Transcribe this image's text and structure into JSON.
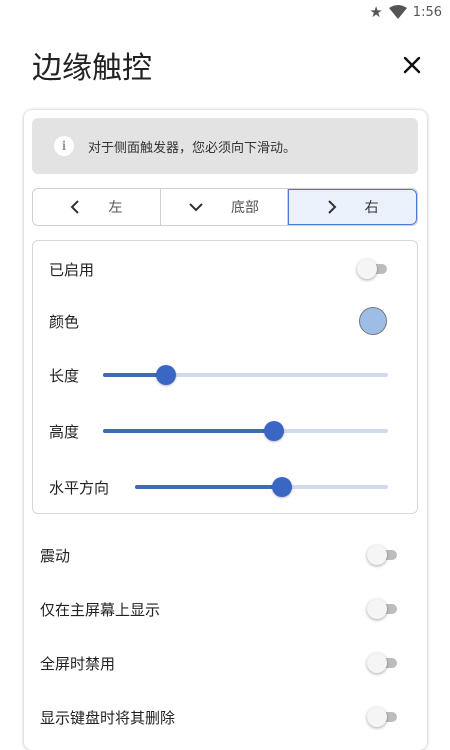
{
  "status_bar": {
    "time": "1:56",
    "icons": [
      "star-icon",
      "wifi-icon",
      "battery-icon"
    ]
  },
  "header": {
    "title": "边缘触控",
    "close_icon": "close-icon"
  },
  "info": {
    "icon": "info-icon",
    "text": "对于侧面触发器，您必须向下滑动。"
  },
  "position_tabs": [
    {
      "label": "左",
      "icon": "chevron-left-icon",
      "selected": false
    },
    {
      "label": "底部",
      "icon": "chevron-down-icon",
      "selected": false
    },
    {
      "label": "右",
      "icon": "chevron-right-icon",
      "selected": true
    }
  ],
  "settings": {
    "enabled": {
      "label": "已启用",
      "on": false
    },
    "color": {
      "label": "颜色",
      "value": "#9dbde6"
    },
    "length": {
      "label": "长度",
      "value": 0.22
    },
    "height": {
      "label": "高度",
      "value": 0.6
    },
    "horizontal": {
      "label": "水平方向",
      "value": 0.58
    }
  },
  "options": [
    {
      "label": "震动",
      "on": false
    },
    {
      "label": "仅在主屏幕上显示",
      "on": false
    },
    {
      "label": "全屏时禁用",
      "on": false
    },
    {
      "label": "显示键盘时将其删除",
      "on": false
    }
  ],
  "colors": {
    "accent": "#3a67c4",
    "selected_tab_bg": "#ebf1fb",
    "info_bg": "#e3e3e3"
  }
}
